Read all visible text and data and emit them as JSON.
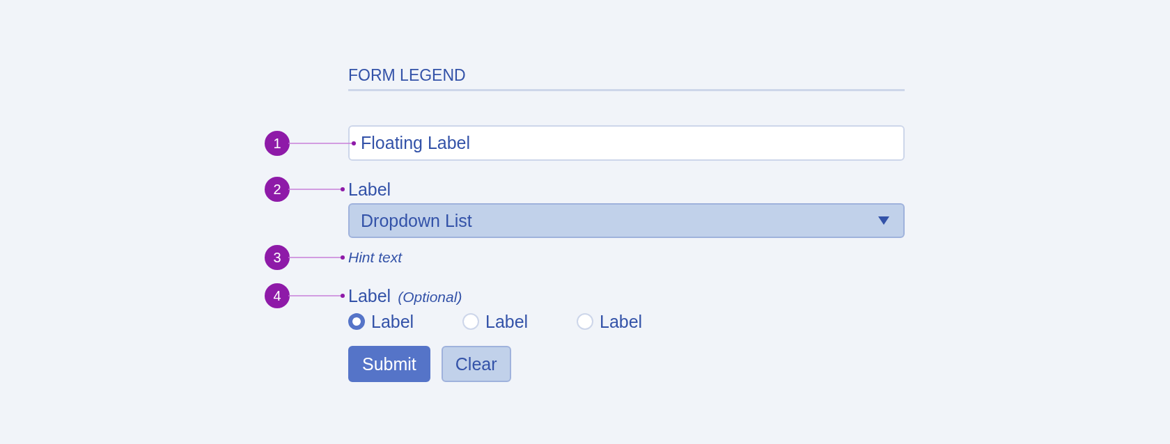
{
  "legend": "FORM LEGEND",
  "text_field": {
    "callout": "1",
    "placeholder": "Floating Label"
  },
  "dropdown": {
    "callout": "2",
    "label": "Label",
    "value": "Dropdown List",
    "hint_callout": "3",
    "hint": "Hint text"
  },
  "radio_group": {
    "callout": "4",
    "label": "Label",
    "note": "(Optional)",
    "options": [
      {
        "label": "Label",
        "selected": true
      },
      {
        "label": "Label",
        "selected": false
      },
      {
        "label": "Label",
        "selected": false
      }
    ]
  },
  "buttons": [
    {
      "label": "Submit",
      "kind": "primary"
    },
    {
      "label": "Clear",
      "kind": "secondary"
    }
  ]
}
